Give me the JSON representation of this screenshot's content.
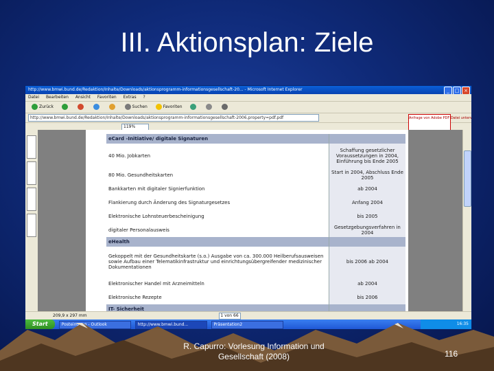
{
  "slide": {
    "title": "III. Aktionsplan: Ziele",
    "footer": "R. Capurro: Vorlesung Information und Gesellschaft (2008)",
    "page_number": "116"
  },
  "browser": {
    "title": "http://www.bmwi.bund.de/Redaktion/Inhalte/Downloads/aktionsprogramm-informationsgesellschaft-20... - Microsoft Internet Explorer",
    "menu": [
      "Datei",
      "Bearbeiten",
      "Ansicht",
      "Favoriten",
      "Extras",
      "?"
    ],
    "toolbar": [
      "Zurück",
      "Suchen",
      "Favoriten"
    ],
    "address": "http://www.bmwi.bund.de/Redaktion/Inhalte/Downloads/aktionsprogramm-informationsgesellschaft-2006,property=pdf.pdf",
    "adobe_box": "Anfrage von Adobe PDF Datei unterwegs",
    "zoom": "119%",
    "status_size": "209,9 x 297 mm",
    "page_nav": "1 von 66"
  },
  "doc_rows": [
    {
      "left": "eCard -Initiative/ digitale Signaturen",
      "right": "",
      "header": true
    },
    {
      "left": "40 Mio. Jobkarten",
      "right": "Schaffung gesetzlicher Voraussetzungen in 2004, Einführung bis Ende 2005"
    },
    {
      "left": "80 Mio. Gesundheitskarten",
      "right": "Start in 2004, Abschluss Ende 2005"
    },
    {
      "left": "Bankkarten mit digitaler Signierfunktion",
      "right": "ab 2004"
    },
    {
      "left": "Flankierung durch Änderung des Signaturgesetzes",
      "right": "Anfang 2004"
    },
    {
      "left": "Elektronische Lohnsteuerbescheinigung",
      "right": "bis 2005"
    },
    {
      "left": "digitaler Personalausweis",
      "right": "Gesetzgebungsverfahren in 2004"
    },
    {
      "left": "eHealth",
      "right": "",
      "header": true
    },
    {
      "left": "Gekoppelt mit der Gesundheitskarte (s.o.) Ausgabe von ca. 300.000 Heilberufsausweisen sowie Aufbau einer Telematikinfrastruktur und einrichtungsübergreifender medizinischer Dokumentationen",
      "right": "bis 2006 ab 2004"
    },
    {
      "left": "Elektronischer Handel mit Arzneimitteln",
      "right": "ab 2004"
    },
    {
      "left": "Elektronische Rezepte",
      "right": "bis 2006"
    },
    {
      "left": "IT- Sicherheit",
      "right": "",
      "header": true
    }
  ],
  "taskbar": {
    "start": "Start",
    "tasks": [
      "Posteingang - Outlook",
      "http://www.bmwi.bund...",
      "Präsentation2"
    ],
    "clock": "16:35"
  },
  "colors": {
    "slide_bg": "#0f2a78",
    "doc_header": "#a8b3cc",
    "doc_right": "#e7e9f1"
  }
}
